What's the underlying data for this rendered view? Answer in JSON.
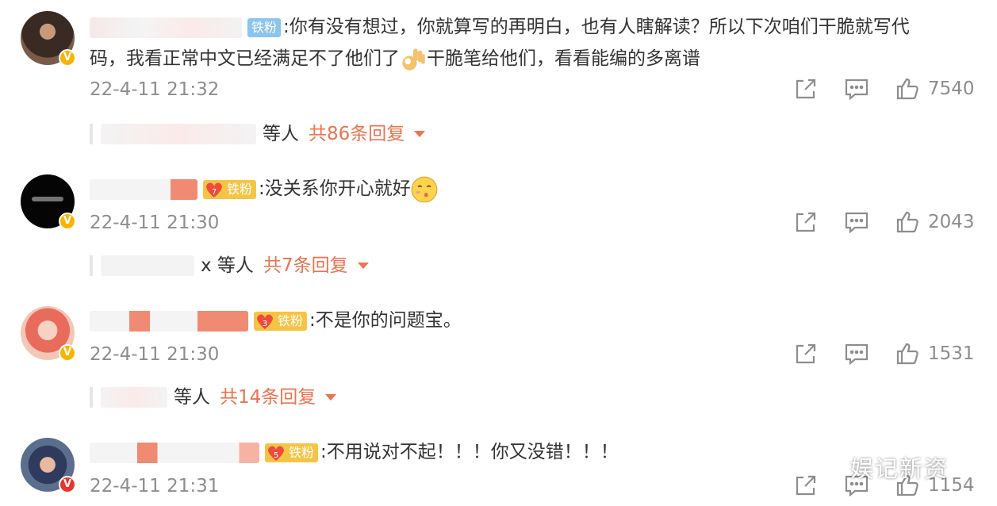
{
  "comments": [
    {
      "badge": "铁粉",
      "badge_style": "blue",
      "text": ":你有没有想过，你就算写的再明白，也有人瞎解读？所以下次咱们干脆就写代",
      "text_line2a": "码，我看正常中文已经满足不了他们了",
      "text_line2b": "干脆笔给他们，看看能编的多离谱",
      "time": "22-4-11 21:32",
      "likes": "7540",
      "replies_suffix": "等人",
      "replies_more": "共86条回复",
      "avatar_badge": "V",
      "avatar_badge_color": "#f7b500"
    },
    {
      "badge": "铁粉",
      "badge_level": "7",
      "text": ":没关系你开心就好",
      "time": "22-4-11 21:30",
      "likes": "2043",
      "replies_suffix": "x 等人",
      "replies_more": "共7条回复",
      "avatar_badge": "V",
      "avatar_badge_color": "#f7b500"
    },
    {
      "badge": "铁粉",
      "badge_level": "3",
      "text": ":不是你的问题宝。",
      "time": "22-4-11 21:30",
      "likes": "1531",
      "replies_suffix": "等人",
      "replies_more": "共14条回复",
      "avatar_badge": "V",
      "avatar_badge_color": "#f7b500"
    },
    {
      "badge": "铁粉",
      "badge_level": "5",
      "text": ":不用说对不起！！！你又没错！！！",
      "time": "22-4-11 21:31",
      "likes": "1154",
      "avatar_badge": "V",
      "avatar_badge_color": "#e8342c"
    }
  ],
  "colors": {
    "accent": "#eb7350",
    "meta": "#8d8d8d",
    "text": "#333333"
  },
  "icons": [
    "share-icon",
    "comment-icon",
    "like-icon",
    "expand-caret-icon",
    "crown-icon",
    "ok-hand-emoji",
    "kiss-emoji"
  ],
  "watermark": "娱记新资"
}
